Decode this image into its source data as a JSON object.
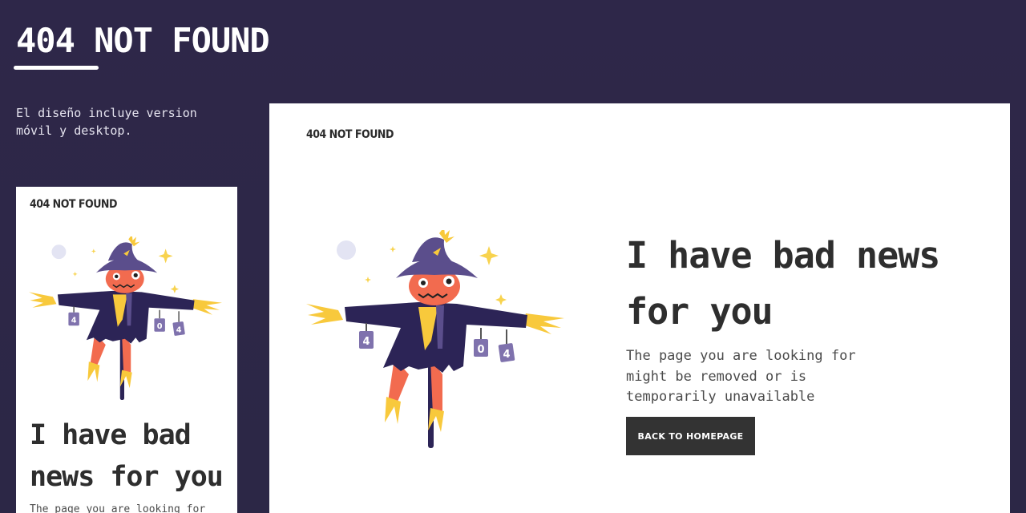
{
  "header": {
    "title": "404 NOT FOUND",
    "description": "El diseño incluye version móvil y desktop."
  },
  "mobile": {
    "logo": "404 NOT FOUND",
    "heading": "I have bad news for you",
    "description": "The page you are looking for"
  },
  "desktop": {
    "logo": "404 NOT FOUND",
    "heading": "I have bad news for you",
    "description": "The page you are looking for might be removed or is temporarily unavailable",
    "button_label": "BACK TO HOMEPAGE"
  },
  "illustration": {
    "name": "scarecrow-illustration",
    "cans": [
      "4",
      "0",
      "4"
    ]
  },
  "colors": {
    "background": "#2d2748",
    "card": "#ffffff",
    "text_dark": "#333333",
    "button": "#333333",
    "hat": "#5b4e8c",
    "coat": "#2c2456",
    "face": "#f26b4f",
    "straw": "#f8c93c",
    "can": "#7f72ad"
  }
}
